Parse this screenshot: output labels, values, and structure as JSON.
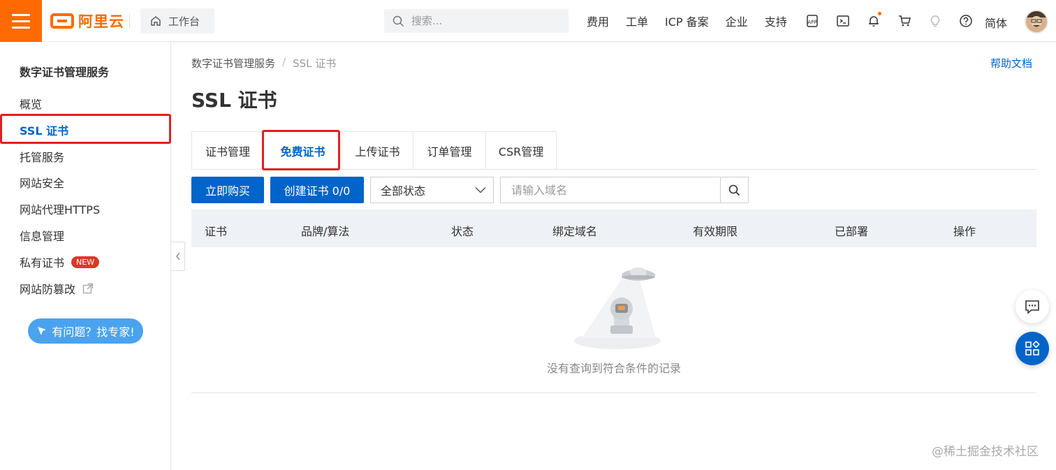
{
  "topbar": {
    "logo_text": "阿里云",
    "workbench": "工作台",
    "search_placeholder": "搜索...",
    "links": [
      "费用",
      "工单",
      "ICP 备案",
      "企业",
      "支持"
    ],
    "icons": [
      "app-icon",
      "terminal-icon",
      "bell-icon",
      "cart-icon",
      "lightbulb-icon",
      "help-icon"
    ],
    "lang": "简体",
    "accent": "#ff6a00"
  },
  "sidebar": {
    "title": "数字证书管理服务",
    "items": [
      {
        "label": "概览"
      },
      {
        "label": "SSL 证书"
      },
      {
        "label": "托管服务"
      },
      {
        "label": "网站安全"
      },
      {
        "label": "网站代理HTTPS"
      },
      {
        "label": "信息管理"
      },
      {
        "label": "私有证书",
        "badge": "NEW"
      },
      {
        "label": "网站防篡改"
      }
    ],
    "expert_button": "有问题？找专家!"
  },
  "main": {
    "breadcrumb": [
      "数字证书管理服务",
      "SSL 证书"
    ],
    "help_link": "帮助文档",
    "title": "SSL 证书",
    "tabs": [
      "证书管理",
      "免费证书",
      "上传证书",
      "订单管理",
      "CSR管理"
    ],
    "active_tab": "免费证书",
    "buy_button": "立即购买",
    "create_button": "创建证书 0/0",
    "status_select": "全部状态",
    "domain_placeholder": "请输入域名",
    "table_headers": [
      "证书",
      "品牌/算法",
      "状态",
      "绑定域名",
      "有效期限",
      "已部署",
      "操作"
    ],
    "empty_text": "没有查询到符合条件的记录"
  },
  "watermark": "@稀土掘金技术社区",
  "colors": {
    "primary": "#0064c8",
    "highlight": "#e0201e"
  }
}
